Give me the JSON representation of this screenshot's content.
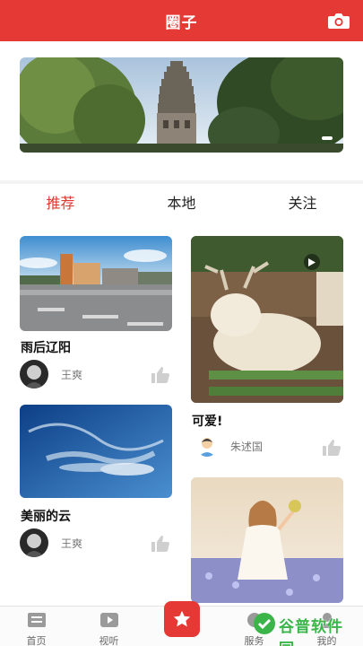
{
  "header": {
    "title": "圈子",
    "camera_icon": "camera-icon"
  },
  "tabs": [
    {
      "label": "推荐",
      "active": true
    },
    {
      "label": "本地",
      "active": false
    },
    {
      "label": "关注",
      "active": false
    }
  ],
  "posts": [
    {
      "title": "雨后辽阳",
      "author": "王爽",
      "image": "rainy-city-street"
    },
    {
      "title": "可爱!",
      "author": "朱述国",
      "image": "white-deer",
      "video": true
    },
    {
      "title": "美丽的云",
      "author": "王爽",
      "image": "blue-cloud-sky"
    },
    {
      "title": "",
      "author": "",
      "image": "girl-in-flower-field"
    }
  ],
  "bottom_nav": [
    {
      "label": "首页",
      "icon": "home-icon"
    },
    {
      "label": "视听",
      "icon": "video-icon"
    },
    {
      "label": "",
      "icon": "star-icon"
    },
    {
      "label": "服务",
      "icon": "service-icon"
    },
    {
      "label": "我的",
      "icon": "user-icon"
    }
  ],
  "watermark": {
    "text": "谷普软件园"
  },
  "colors": {
    "brand_red": "#e53935",
    "tab_active": "#d93a2f"
  }
}
